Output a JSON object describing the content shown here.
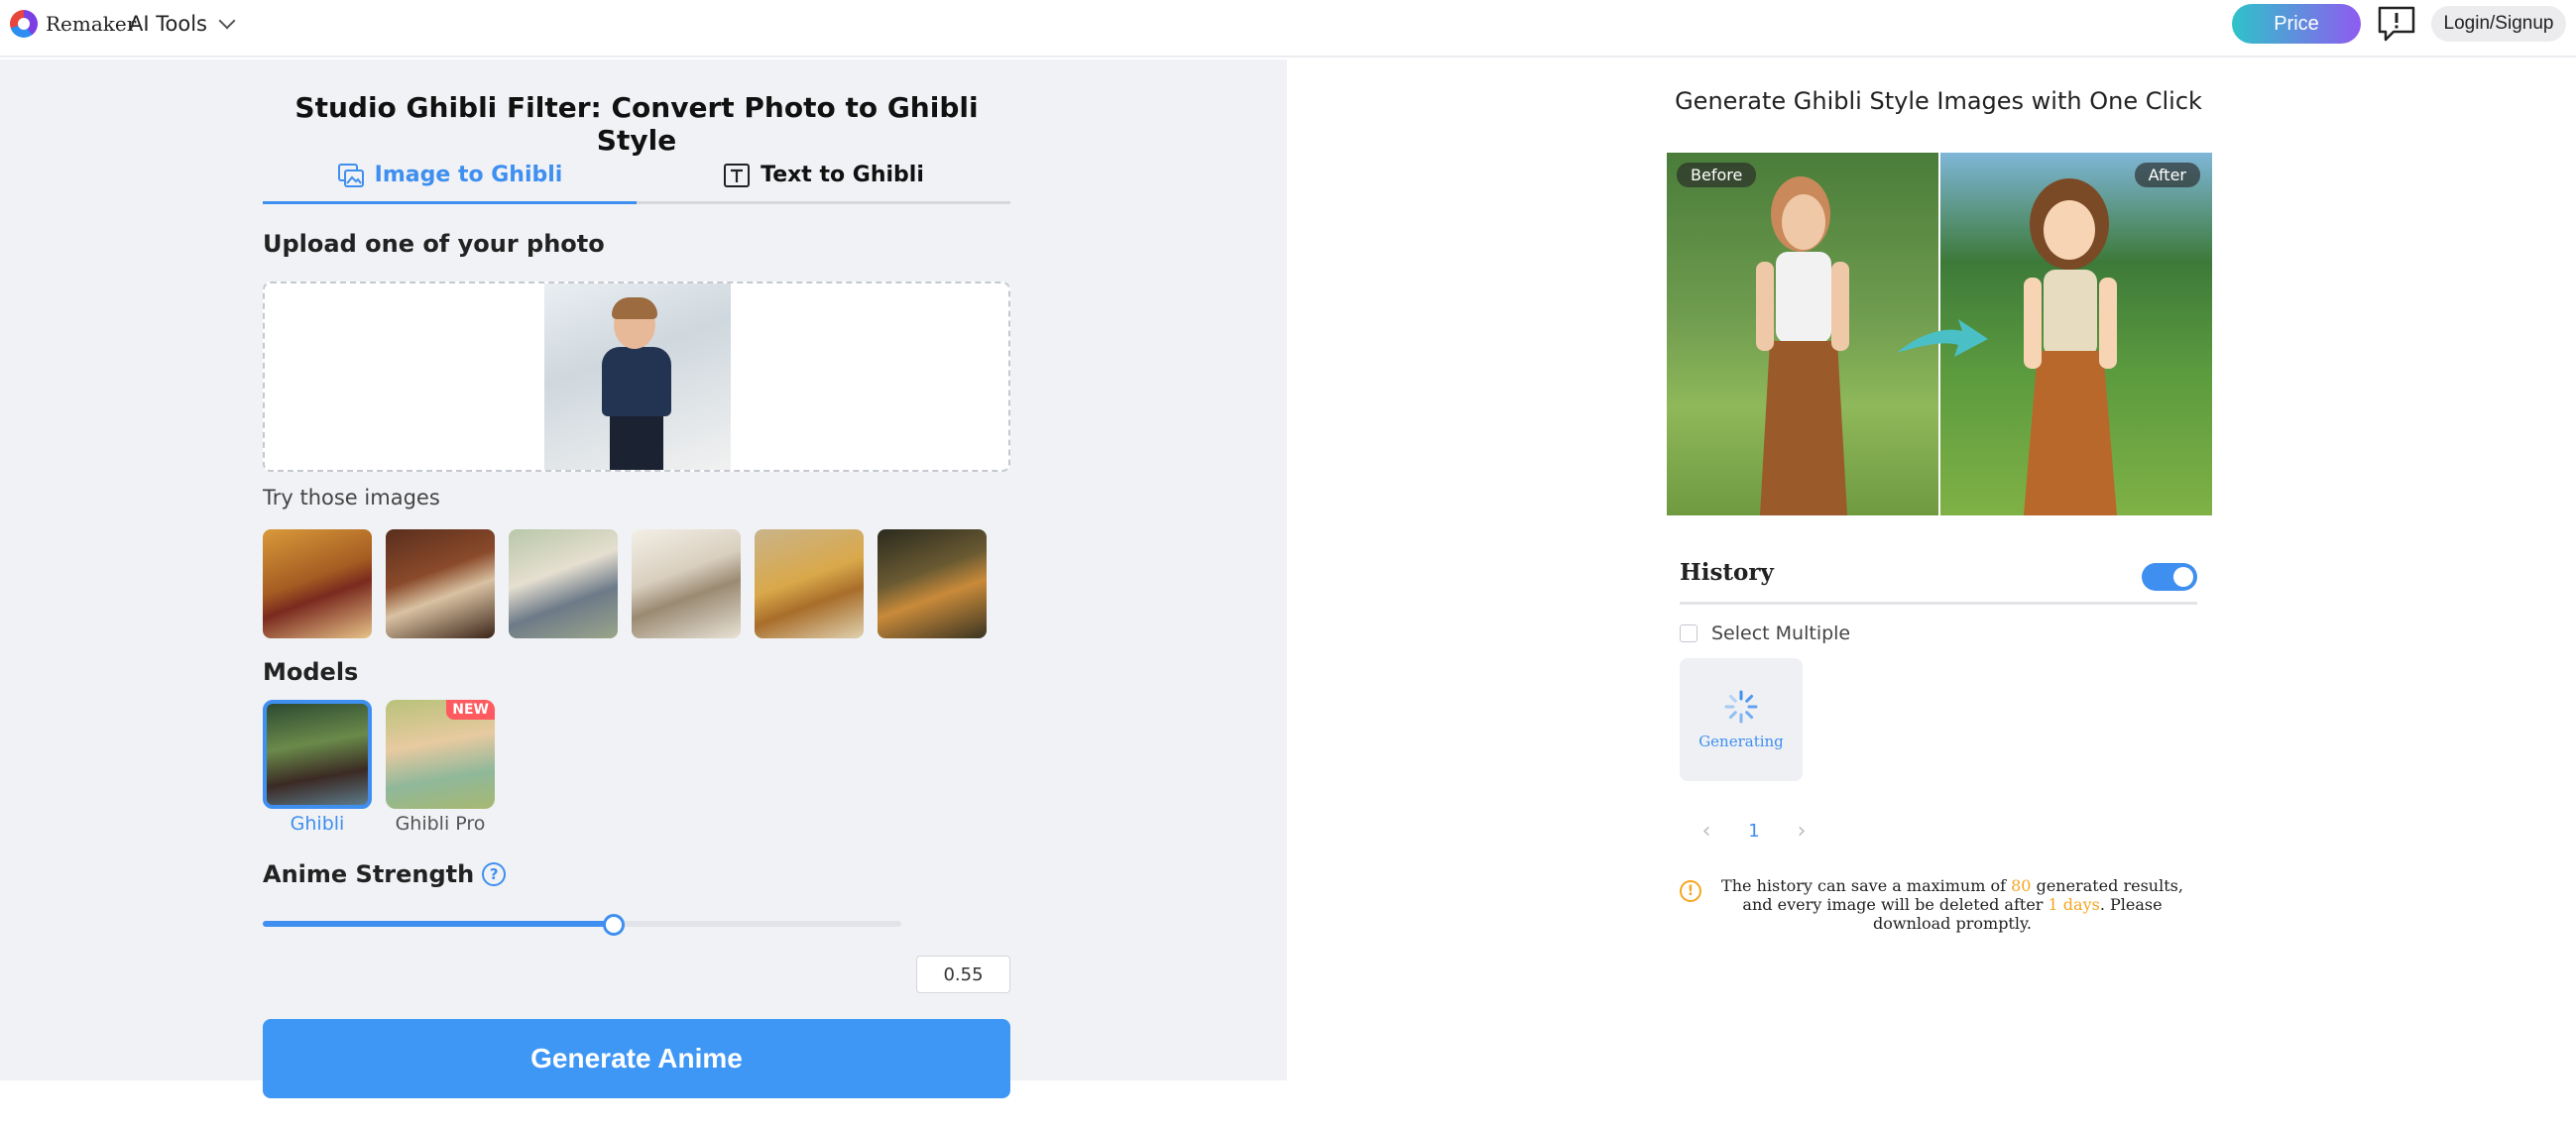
{
  "header": {
    "brand": "Remaker",
    "ai_tools": "AI Tools",
    "price": "Price",
    "login": "Login/Signup"
  },
  "left": {
    "title": "Studio Ghibli Filter: Convert Photo to Ghibli Style",
    "tabs": [
      {
        "label": "Image to Ghibli",
        "active": true
      },
      {
        "label": "Text to Ghibli",
        "active": false
      }
    ],
    "upload_label": "Upload one of your photo",
    "try_label": "Try those images",
    "models_label": "Models",
    "models": [
      {
        "label": "Ghibli",
        "selected": true
      },
      {
        "label": "Ghibli Pro",
        "selected": false,
        "badge": "NEW"
      }
    ],
    "strength_label": "Anime Strength",
    "strength_value": "0.55",
    "generate_label": "Generate Anime"
  },
  "right": {
    "title": "Generate Ghibli Style Images with One Click",
    "before_tag": "Before",
    "after_tag": "After",
    "history_title": "History",
    "history_toggle_on": true,
    "select_multiple": "Select Multiple",
    "generating": "Generating",
    "page": "1",
    "notice": {
      "part1": "The history can save a maximum of ",
      "max": "80",
      "part2": " generated results, and every image will be deleted after ",
      "days": "1 days",
      "part3": ". Please download promptly."
    }
  },
  "colors": {
    "accent": "#3f8ff0",
    "panel_bg": "#f0f2f5",
    "warning": "#f5a623"
  }
}
